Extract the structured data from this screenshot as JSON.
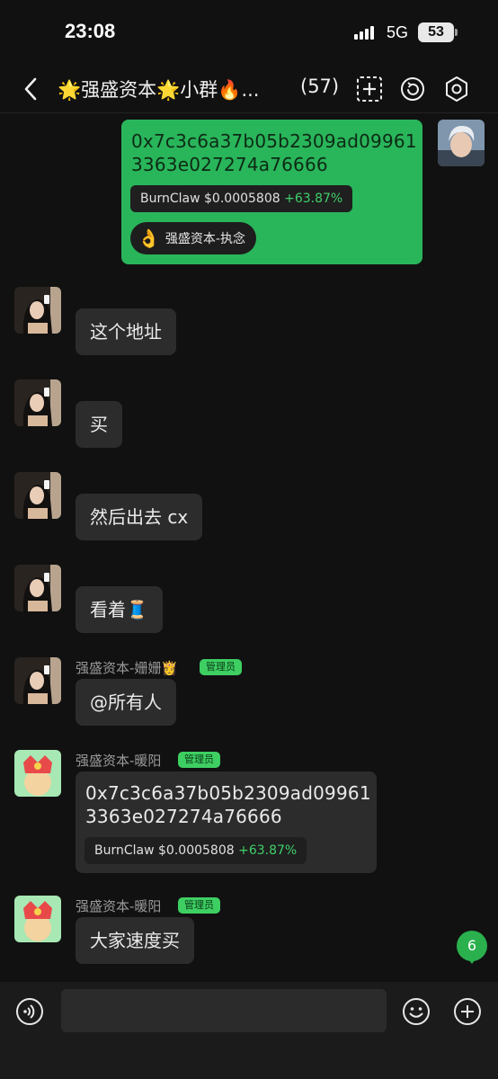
{
  "status": {
    "time": "23:08",
    "network": "5G",
    "battery": "53"
  },
  "header": {
    "title": "🌟强盛资本🌟小群🔥...",
    "member_count": "(57)"
  },
  "messages": {
    "m1": {
      "address": "0x7c3c6a37b05b2309ad099613363e027274a76666",
      "token": "BurnClaw",
      "price": "$0.0005808",
      "change": "+63.87%",
      "reaction_emoji": "👌",
      "reaction_name": "强盛资本-执念"
    },
    "m2": {
      "text": "这个地址"
    },
    "m3": {
      "text": "买"
    },
    "m4": {
      "text": "然后出去 cx"
    },
    "m5": {
      "text": "看着🧵"
    },
    "m6": {
      "sender": "强盛资本-姗姗👸",
      "badge": "管理员",
      "text": "@所有人"
    },
    "m7": {
      "sender": "强盛资本-暖阳",
      "badge": "管理员",
      "address": "0x7c3c6a37b05b2309ad099613363e027274a76666",
      "token": "BurnClaw",
      "price": "$0.0005808",
      "change": "+63.87%"
    },
    "m8": {
      "sender": "强盛资本-暖阳",
      "badge": "管理员",
      "text": "大家速度买"
    }
  },
  "unread_count": "6",
  "colors": {
    "accent": "#29b55a",
    "bubble": "#2c2c2c",
    "background": "#111111",
    "positive": "#3fcf6a"
  },
  "icons": [
    "back-icon",
    "add-member-icon",
    "refresh-icon",
    "settings-icon",
    "voice-icon",
    "emoji-icon",
    "plus-icon"
  ]
}
